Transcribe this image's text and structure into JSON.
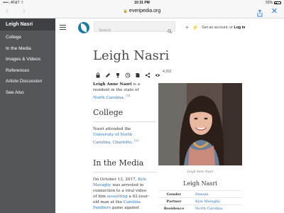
{
  "status_bar": {
    "carrier": "••••○ AT&T ⌔",
    "time": "10:31 PM",
    "battery_text": "31%",
    "battery_level": 0.31
  },
  "browser": {
    "url": "everipedia.org",
    "back_icon": "chevron-left-icon",
    "forward_icon": "chevron-right-icon",
    "share_icon": "share-icon",
    "close_icon": "close-icon"
  },
  "sidebar": {
    "title": "Leigh Nasri",
    "items": [
      {
        "label": "College"
      },
      {
        "label": "In the Media"
      },
      {
        "label": "Images & Videos"
      },
      {
        "label": "References"
      },
      {
        "label": "Article Discussion"
      },
      {
        "label": "See Also"
      }
    ]
  },
  "header": {
    "search_placeholder": "Search",
    "plus": "+",
    "bolt": "⚡",
    "account_text": "Get an account, or ",
    "login_label": "Log in"
  },
  "article": {
    "title": "Leigh Nasri",
    "view_count": "4,262",
    "intro": {
      "name_bold": "Leigh Anne Nasri",
      "text": " is a resident in the state of ",
      "link": "North Carolina",
      "period": ".",
      "ref": "[1]"
    },
    "college": {
      "heading": "College",
      "text": "Nasri attended the ",
      "link": "University of North Carolina, Charlotte",
      "period": ".",
      "ref": "[2]"
    },
    "media": {
      "heading": "In the Media",
      "t1": "On October 13, 2017, ",
      "link1": "Kyle Maraghy",
      "t2": " was arrested in connection to a viral video of him ",
      "link2": "assaulting",
      "t3": " a 62-year-old man at the ",
      "link3": "Carolina Panthers",
      "t4": " game against"
    },
    "photo_caption": "Leigh Anne Nasri",
    "infobox": {
      "title": "Leigh Nasri",
      "rows": [
        {
          "key": "Gender",
          "value": "Female"
        },
        {
          "key": "Partner",
          "value": "Kyle Maraghy"
        },
        {
          "key": "Residence",
          "value": "North Carolina"
        }
      ]
    }
  },
  "colors": {
    "sidebar_bg": "#55565a",
    "sidebar_title_bg": "#3f4044",
    "link": "#2f74c0",
    "safari_blue": "#2a7ae2"
  }
}
